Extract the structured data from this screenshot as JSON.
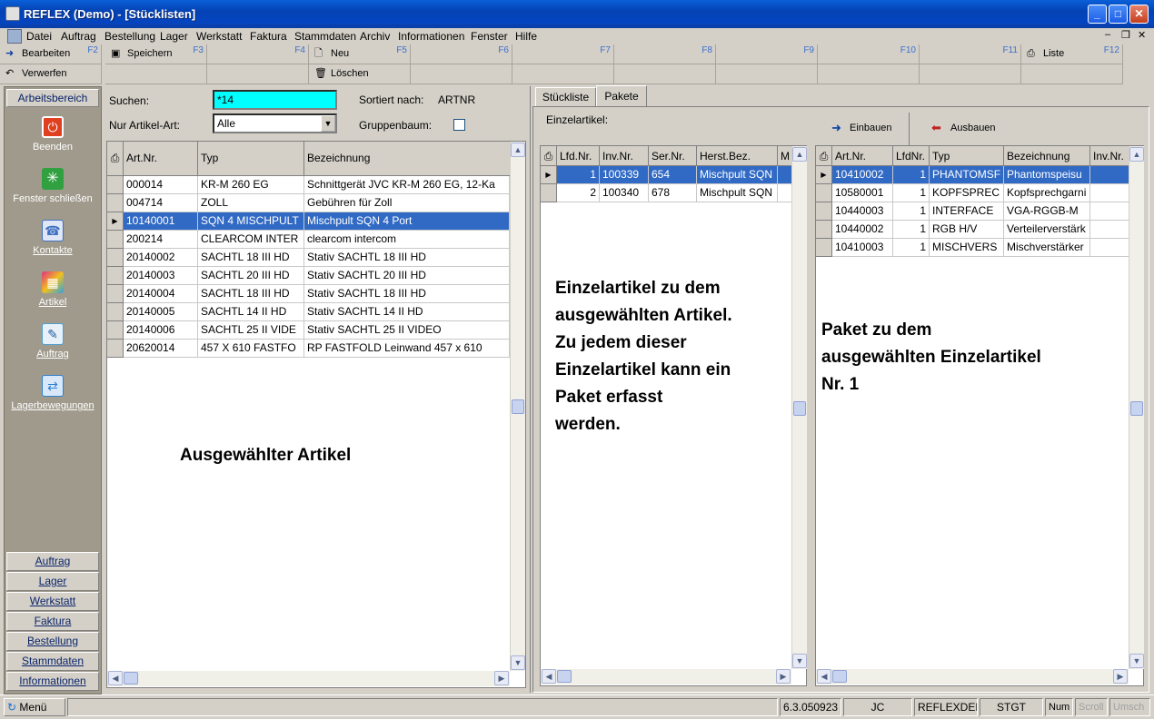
{
  "window": {
    "title": "REFLEX (Demo) - [Stücklisten]"
  },
  "menu": [
    "Datei",
    "Auftrag",
    "Bestellung",
    "Lager",
    "Werkstatt",
    "Faktura",
    "Stammdaten",
    "Archiv",
    "Informationen",
    "Fenster",
    "Hilfe"
  ],
  "toolbar": {
    "row1": [
      {
        "label": "Bearbeiten",
        "key": "F2",
        "icon": "arrow-right-icon"
      },
      {
        "label": "Speichern",
        "key": "F3",
        "icon": "save-icon"
      },
      {
        "label": "",
        "key": "F4"
      },
      {
        "label": "Neu",
        "key": "F5",
        "icon": "new-doc-icon"
      },
      {
        "label": "",
        "key": "F6"
      },
      {
        "label": "",
        "key": "F7"
      },
      {
        "label": "",
        "key": "F8"
      },
      {
        "label": "",
        "key": "F9"
      },
      {
        "label": "",
        "key": "F10"
      },
      {
        "label": "",
        "key": "F11"
      },
      {
        "label": "Liste",
        "key": "F12",
        "icon": "print-icon"
      }
    ],
    "row2": [
      {
        "label": "Verwerfen",
        "icon": "undo-icon"
      },
      {
        "label": ""
      },
      {
        "label": ""
      },
      {
        "label": "Löschen",
        "icon": "trash-icon"
      }
    ]
  },
  "sidebar": {
    "header": "Arbeitsbereich",
    "items": [
      {
        "label": "Beenden",
        "icon": "power-icon",
        "color": "#e04020"
      },
      {
        "label": "Fenster schließen",
        "icon": "window-close-icon",
        "color": "#30a040"
      },
      {
        "label": "Kontakte",
        "icon": "contacts-icon",
        "color": "#4070c0"
      },
      {
        "label": "Artikel",
        "icon": "artikel-icon",
        "color": "#c040a0"
      },
      {
        "label": "Auftrag",
        "icon": "auftrag-icon",
        "color": "#50a0d0"
      },
      {
        "label": "Lagerbewegungen",
        "icon": "lager-icon",
        "color": "#3080d0"
      }
    ],
    "bottom": [
      "Auftrag",
      "Lager",
      "Werkstatt",
      "Faktura",
      "Bestellung",
      "Stammdaten",
      "Informationen"
    ]
  },
  "search": {
    "label": "Suchen:",
    "value": "*14",
    "sorted_label": "Sortiert nach:",
    "sorted_value": "ARTNR",
    "type_label": "Nur Artikel-Art:",
    "type_value": "Alle",
    "tree_label": "Gruppenbaum:"
  },
  "articles": {
    "columns": [
      "Art.Nr.",
      "Typ",
      "Bezeichnung"
    ],
    "rows": [
      [
        "000014",
        "KR-M 260 EG",
        "Schnittgerät JVC KR-M 260 EG, 12-Ka"
      ],
      [
        "004714",
        "ZOLL",
        "Gebühren für Zoll"
      ],
      [
        "10140001",
        "SQN 4 MISCHPULT",
        "Mischpult SQN 4 Port"
      ],
      [
        "200214",
        "CLEARCOM INTER",
        "clearcom intercom"
      ],
      [
        "20140002",
        "SACHTL 18 III HD",
        "Stativ SACHTL 18 III HD"
      ],
      [
        "20140003",
        "SACHTL 20 III HD",
        "Stativ SACHTL 20 III HD"
      ],
      [
        "20140004",
        "SACHTL 18 III HD",
        "Stativ SACHTL 18 III HD"
      ],
      [
        "20140005",
        "SACHTL 14 II HD",
        "Stativ SACHTL 14 II HD"
      ],
      [
        "20140006",
        "SACHTL 25 II VIDE",
        "Stativ SACHTL 25 II VIDEO"
      ],
      [
        "20620014",
        "457 X 610 FASTFO",
        "RP FASTFOLD Leinwand 457 x 610"
      ]
    ],
    "selected_index": 2
  },
  "tabs": [
    "Stückliste",
    "Pakete"
  ],
  "einzel": {
    "label": "Einzelartikel:",
    "columns": [
      "Lfd.Nr.",
      "Inv.Nr.",
      "Ser.Nr.",
      "Herst.Bez.",
      "M"
    ],
    "rows": [
      [
        "1",
        "100339",
        "654",
        "Mischpult SQN"
      ],
      [
        "2",
        "100340",
        "678",
        "Mischpult SQN"
      ]
    ]
  },
  "paket": {
    "einbauen": "Einbauen",
    "ausbauen": "Ausbauen",
    "columns": [
      "Art.Nr.",
      "LfdNr.",
      "Typ",
      "Bezeichnung",
      "Inv.Nr."
    ],
    "rows": [
      [
        "10410002",
        "1",
        "PHANTOMSF",
        "Phantomspeisu"
      ],
      [
        "10580001",
        "1",
        "KOPFSPREC",
        "Kopfsprechgarni"
      ],
      [
        "10440003",
        "1",
        "INTERFACE",
        "VGA-RGGB-M"
      ],
      [
        "10440002",
        "1",
        "RGB H/V",
        "Verteilerverstärk"
      ],
      [
        "10410003",
        "1",
        "MISCHVERS",
        "Mischverstärker"
      ]
    ]
  },
  "notes": {
    "left": "Ausgewählter Artikel",
    "middle": [
      "Einzelartikel zu dem",
      "ausgewählten Artikel.",
      "Zu jedem dieser",
      "Einzelartikel kann ein",
      "Paket erfasst",
      "werden."
    ],
    "right": [
      "Paket zu dem",
      "ausgewählten Einzelartikel",
      "Nr. 1"
    ]
  },
  "status": {
    "menu": "Menü",
    "version": "6.3.050923",
    "user": "JC",
    "db": "REFLEXDEMO",
    "site": "STGT",
    "num": "Num",
    "scroll": "Scroll",
    "umsch": "Umsch"
  },
  "colors": {
    "selection": "#316ac5",
    "search_bg": "#00ffff",
    "titlebar": "#0a5fd8"
  }
}
